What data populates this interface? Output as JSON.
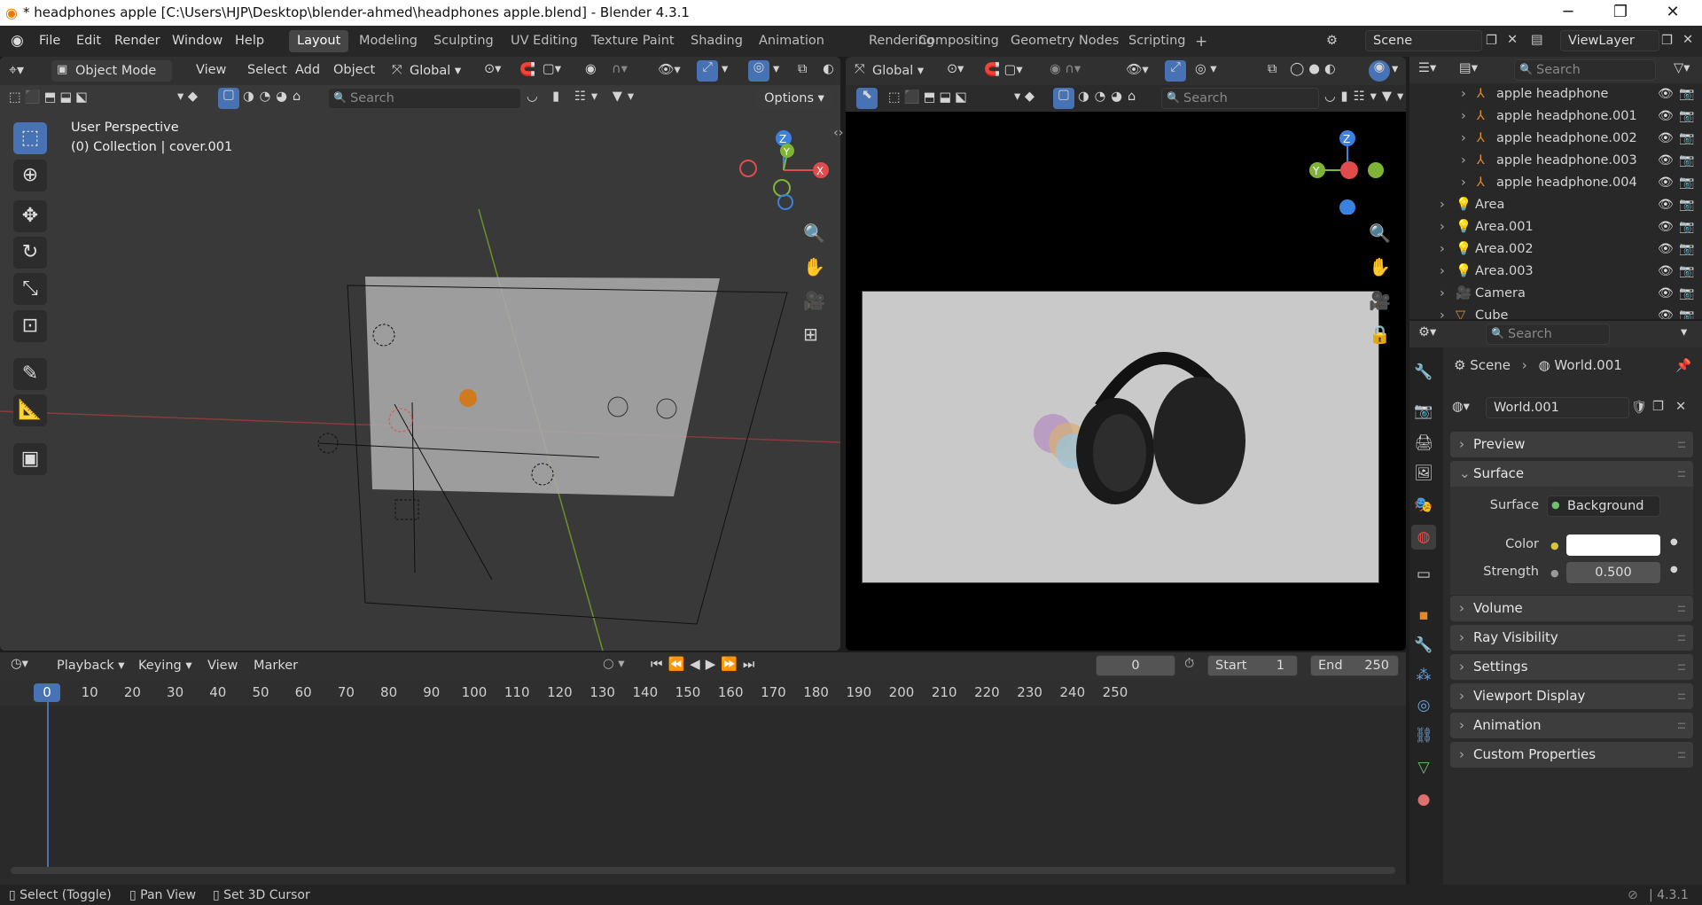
{
  "window": {
    "title": "* headphones apple [C:\\Users\\HJP\\Desktop\\blender-ahmed\\headphones apple.blend] - Blender 4.3.1",
    "min_icon": "minimize-icon",
    "max_icon": "maximize-icon",
    "close_icon": "close-icon"
  },
  "menu": {
    "items": [
      "File",
      "Edit",
      "Render",
      "Window",
      "Help"
    ]
  },
  "workspaces": {
    "tabs": [
      "Layout",
      "Modeling",
      "Sculpting",
      "UV Editing",
      "Texture Paint",
      "Shading",
      "Animation",
      "Rendering",
      "Compositing",
      "Geometry Nodes",
      "Scripting"
    ],
    "active": "Layout",
    "add": "+"
  },
  "scene": {
    "name": "Scene",
    "viewlayer": "ViewLayer"
  },
  "viewport_left": {
    "mode": "Object Mode",
    "menus": [
      "View",
      "Select",
      "Add",
      "Object"
    ],
    "orientation": "Global",
    "search_placeholder": "Search",
    "options": "Options",
    "overlay_line1": "User Perspective",
    "overlay_line2": "(0) Collection | cover.001"
  },
  "viewport_right": {
    "orientation": "Global",
    "search_placeholder": "Search"
  },
  "gizmo": {
    "z": "Z",
    "y": "Y",
    "x": "X"
  },
  "outliner": {
    "search_placeholder": "Search",
    "items": [
      {
        "label": "apple headphone",
        "indent": 2
      },
      {
        "label": "apple headphone.001",
        "indent": 2
      },
      {
        "label": "apple headphone.002",
        "indent": 2
      },
      {
        "label": "apple headphone.003",
        "indent": 2
      },
      {
        "label": "apple headphone.004",
        "indent": 2
      },
      {
        "label": "Area",
        "indent": 1
      },
      {
        "label": "Area.001",
        "indent": 1
      },
      {
        "label": "Area.002",
        "indent": 1
      },
      {
        "label": "Area.003",
        "indent": 1
      },
      {
        "label": "Camera",
        "indent": 1
      },
      {
        "label": "Cube",
        "indent": 1
      }
    ]
  },
  "properties": {
    "search_placeholder": "Search",
    "breadcrumb_scene": "Scene",
    "breadcrumb_world": "World.001",
    "world_name": "World.001",
    "panels": {
      "preview": "Preview",
      "surface": "Surface",
      "volume": "Volume",
      "ray_visibility": "Ray Visibility",
      "settings": "Settings",
      "viewport_display": "Viewport Display",
      "animation": "Animation",
      "custom_properties": "Custom Properties"
    },
    "surface_label": "Surface",
    "surface_value": "Background",
    "color_label": "Color",
    "color_value": "#ffffff",
    "strength_label": "Strength",
    "strength_value": "0.500"
  },
  "timeline": {
    "menus": [
      "Playback",
      "Keying",
      "View",
      "Marker"
    ],
    "current_frame": "0",
    "start_label": "Start",
    "start_value": "1",
    "end_label": "End",
    "end_value": "250",
    "ticks": [
      "0",
      "10",
      "20",
      "30",
      "40",
      "50",
      "60",
      "70",
      "80",
      "90",
      "100",
      "110",
      "120",
      "130",
      "140",
      "150",
      "160",
      "170",
      "180",
      "190",
      "200",
      "210",
      "220",
      "230",
      "240",
      "250"
    ]
  },
  "statusbar": {
    "select": "Select (Toggle)",
    "pan": "Pan View",
    "cursor": "Set 3D Cursor",
    "version": "4.3.1"
  }
}
